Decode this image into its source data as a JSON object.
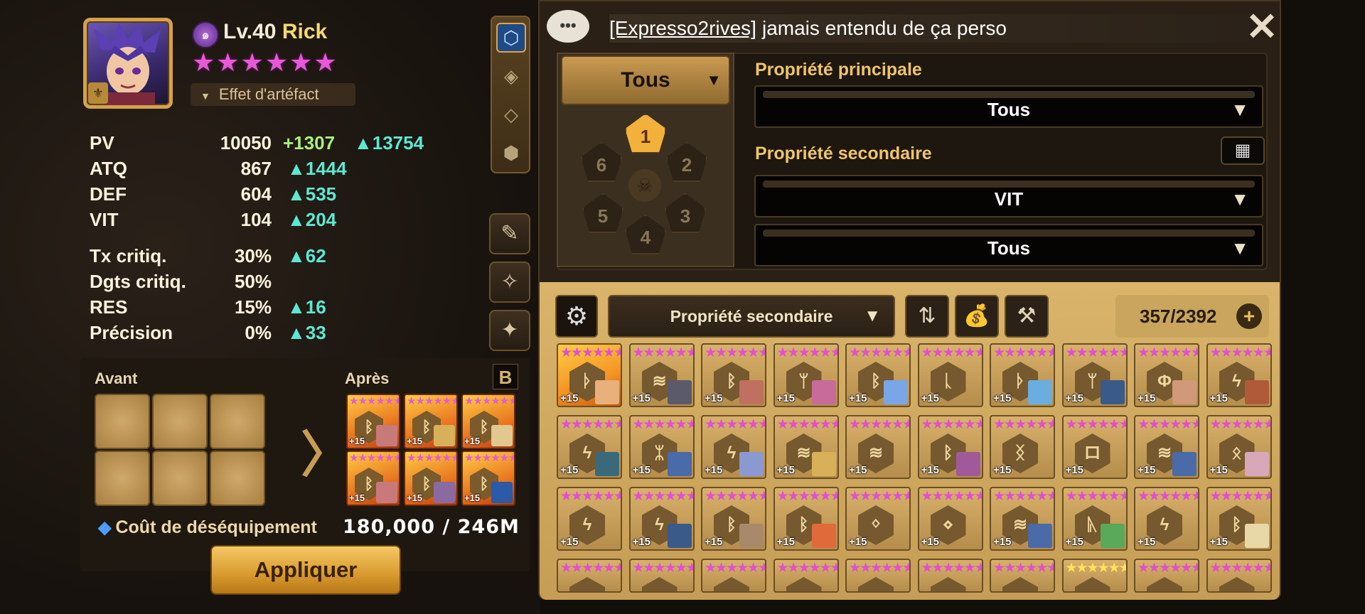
{
  "monster": {
    "level": "Lv.40",
    "name": "Rick",
    "stars": "★★★★★★",
    "element_icon": "wind-element-icon",
    "artifact_label": "Effet d'artéfact"
  },
  "stats": [
    {
      "label": "PV",
      "base": "10050",
      "bonus1": "+1307",
      "bonus2": "▲13754"
    },
    {
      "label": "ATQ",
      "base": "867",
      "bonus1": "▲1444",
      "bonus2": ""
    },
    {
      "label": "DEF",
      "base": "604",
      "bonus1": "▲535",
      "bonus2": ""
    },
    {
      "label": "VIT",
      "base": "104",
      "bonus1": "▲204",
      "bonus2": ""
    },
    {
      "label": "Tx critiq.",
      "base": "30%",
      "bonus1": "▲62",
      "bonus2": ""
    },
    {
      "label": "Dgts critiq.",
      "base": "50%",
      "bonus1": "",
      "bonus2": ""
    },
    {
      "label": "RES",
      "base": "15%",
      "bonus1": "▲16",
      "bonus2": ""
    },
    {
      "label": "Précision",
      "base": "0%",
      "bonus1": "▲33",
      "bonus2": ""
    }
  ],
  "compare": {
    "before_label": "Avant",
    "after_label": "Après",
    "b_badge": "B",
    "after_runes": [
      {
        "stars": "★★★★★★",
        "level": "+15",
        "glyph": "ᛒ"
      },
      {
        "stars": "★★★★★★",
        "level": "+15",
        "glyph": "ᛒ"
      },
      {
        "stars": "★★★★★★",
        "level": "+15",
        "glyph": "ᛒ"
      },
      {
        "stars": "★★★★★★",
        "level": "+15",
        "glyph": "ᛒ"
      },
      {
        "stars": "★★★★★★",
        "level": "+15",
        "glyph": "ᛒ"
      },
      {
        "stars": "★★★★★★",
        "level": "+15",
        "glyph": "ᛒ"
      }
    ],
    "cost_label": "Coût de déséquipement",
    "cost_value": "180,000 / 246M",
    "apply_label": "Appliquer"
  },
  "chat": {
    "user": "[Expresso2rives]",
    "message": "jamais entendu de ça perso"
  },
  "filters": {
    "slot_dropdown": "Tous",
    "slots": [
      "1",
      "2",
      "3",
      "4",
      "5",
      "6"
    ],
    "selected_slot": "1",
    "main_label": "Propriété principale",
    "main_value": "Tous",
    "sub_label": "Propriété secondaire",
    "sub_value1": "VIT",
    "sub_value2": "Tous"
  },
  "inventory": {
    "sort_label": "Propriété secondaire",
    "count": "357/2392",
    "runes": [
      {
        "glyph": "ᚦ",
        "level": "+15",
        "legend": true,
        "hero": "#e8b07a"
      },
      {
        "glyph": "≋",
        "level": "+15",
        "legend": false,
        "hero": "#5a5a6a"
      },
      {
        "glyph": "ᛒ",
        "level": "+15",
        "legend": false,
        "hero": "#c07060"
      },
      {
        "glyph": "ᛘ",
        "level": "+15",
        "legend": false,
        "hero": "#c86a9a"
      },
      {
        "glyph": "ᛒ",
        "level": "+15",
        "legend": false,
        "hero": "#7aa6e8"
      },
      {
        "glyph": "ᚳ",
        "level": "+15",
        "legend": false,
        "hero": ""
      },
      {
        "glyph": "ᚦ",
        "level": "+15",
        "legend": false,
        "hero": "#6aaee0"
      },
      {
        "glyph": "ᛘ",
        "level": "+15",
        "legend": false,
        "hero": "#3a5a8a"
      },
      {
        "glyph": "Φ",
        "level": "+15",
        "legend": false,
        "hero": "#d09a7a"
      },
      {
        "glyph": "ϟ",
        "level": "+15",
        "legend": false,
        "hero": "#b05a3a"
      },
      {
        "glyph": "ϟ",
        "level": "+15",
        "legend": false,
        "hero": "#3a6a7a"
      },
      {
        "glyph": "ᛯ",
        "level": "+15",
        "legend": false,
        "hero": "#4a6aa8"
      },
      {
        "glyph": "ϟ",
        "level": "+15",
        "legend": false,
        "hero": "#8a9ad0"
      },
      {
        "glyph": "≋",
        "level": "+15",
        "legend": false,
        "hero": "#d8b05a"
      },
      {
        "glyph": "≋",
        "level": "+15",
        "legend": false,
        "hero": ""
      },
      {
        "glyph": "ᛒ",
        "level": "+15",
        "legend": false,
        "hero": "#a05a9a"
      },
      {
        "glyph": "ᛝ",
        "level": "+15",
        "legend": false,
        "hero": ""
      },
      {
        "glyph": "ロ",
        "level": "+15",
        "legend": false,
        "hero": ""
      },
      {
        "glyph": "≋",
        "level": "+15",
        "legend": false,
        "hero": "#4a6aa8"
      },
      {
        "glyph": "ᛟ",
        "level": "+15",
        "legend": false,
        "hero": "#d8a8b8"
      },
      {
        "glyph": "ϟ",
        "level": "+15",
        "legend": false,
        "hero": ""
      },
      {
        "glyph": "ϟ",
        "level": "+15",
        "legend": false,
        "hero": "#3a5a8a"
      },
      {
        "glyph": "ᛒ",
        "level": "+15",
        "legend": false,
        "hero": "#a88a6a"
      },
      {
        "glyph": "ᛒ",
        "level": "+15",
        "legend": false,
        "hero": "#e06a3a"
      },
      {
        "glyph": "ᛜ",
        "level": "+15",
        "legend": false,
        "hero": ""
      },
      {
        "glyph": "⋄",
        "level": "+15",
        "legend": false,
        "hero": ""
      },
      {
        "glyph": "≋",
        "level": "+15",
        "legend": false,
        "hero": "#4a6aa8"
      },
      {
        "glyph": "ᚣ",
        "level": "+15",
        "legend": false,
        "hero": "#5aa85a"
      },
      {
        "glyph": "ϟ",
        "level": "+15",
        "legend": false,
        "hero": ""
      },
      {
        "glyph": "ᛒ",
        "level": "+15",
        "legend": false,
        "hero": "#e8d8a8"
      },
      {
        "glyph": "",
        "level": "",
        "legend": false,
        "hero": ""
      },
      {
        "glyph": "",
        "level": "",
        "legend": false,
        "hero": ""
      },
      {
        "glyph": "",
        "level": "",
        "legend": false,
        "hero": ""
      },
      {
        "glyph": "",
        "level": "",
        "legend": false,
        "hero": ""
      },
      {
        "glyph": "",
        "level": "",
        "legend": false,
        "hero": ""
      },
      {
        "glyph": "",
        "level": "",
        "legend": false,
        "hero": ""
      },
      {
        "glyph": "",
        "level": "",
        "legend": false,
        "hero": ""
      },
      {
        "glyph": "",
        "level": "",
        "legend": false,
        "hero": "",
        "gold": true
      },
      {
        "glyph": "",
        "level": "",
        "legend": false,
        "hero": ""
      },
      {
        "glyph": "",
        "level": "",
        "legend": false,
        "hero": ""
      }
    ],
    "rune_stars": "★★★★★★"
  }
}
